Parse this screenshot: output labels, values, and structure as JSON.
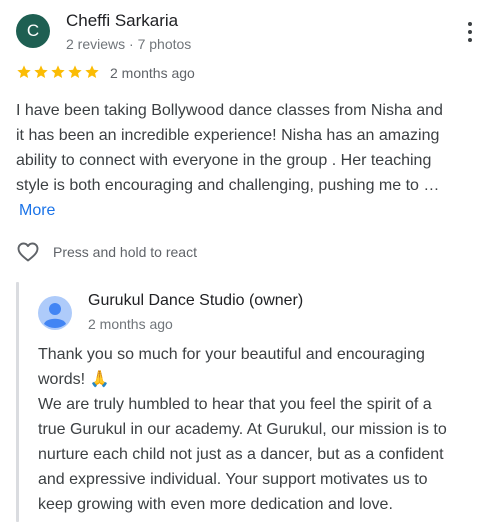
{
  "review": {
    "avatar_letter": "C",
    "avatar_color": "#1e5f52",
    "reviewer_name": "Cheffi Sarkaria",
    "reviewer_meta": "2 reviews · 7 photos",
    "rating": 5,
    "star_color": "#fbbc04",
    "date": "2 months ago",
    "text_lines": [
      "I have been taking Bollywood dance classes from Nisha and",
      "it has been an incredible experience! Nisha has an amazing",
      "ability to connect with everyone in the group . Her teaching",
      "style is both encouraging and challenging, pushing me to …"
    ],
    "more_label": "More",
    "more_color": "#1a73e8",
    "more_menu_icon": "more-vert-icon"
  },
  "reaction": {
    "icon": "heart-icon",
    "label": "Press and hold to react"
  },
  "owner_reply": {
    "avatar_icon": "person-icon",
    "name": "Gurukul Dance Studio (owner)",
    "date": "2 months ago",
    "text_lines": [
      "Thank you so much for your beautiful and encouraging",
      "words! 🙏",
      "We are truly humbled to hear that you feel the spirit of a",
      "true Gurukul in our academy. At Gurukul, our mission is to",
      "nurture each child not just as a dancer, but as a confident",
      "and expressive individual. Your support motivates us to",
      "keep growing with even more dedication and love."
    ]
  }
}
